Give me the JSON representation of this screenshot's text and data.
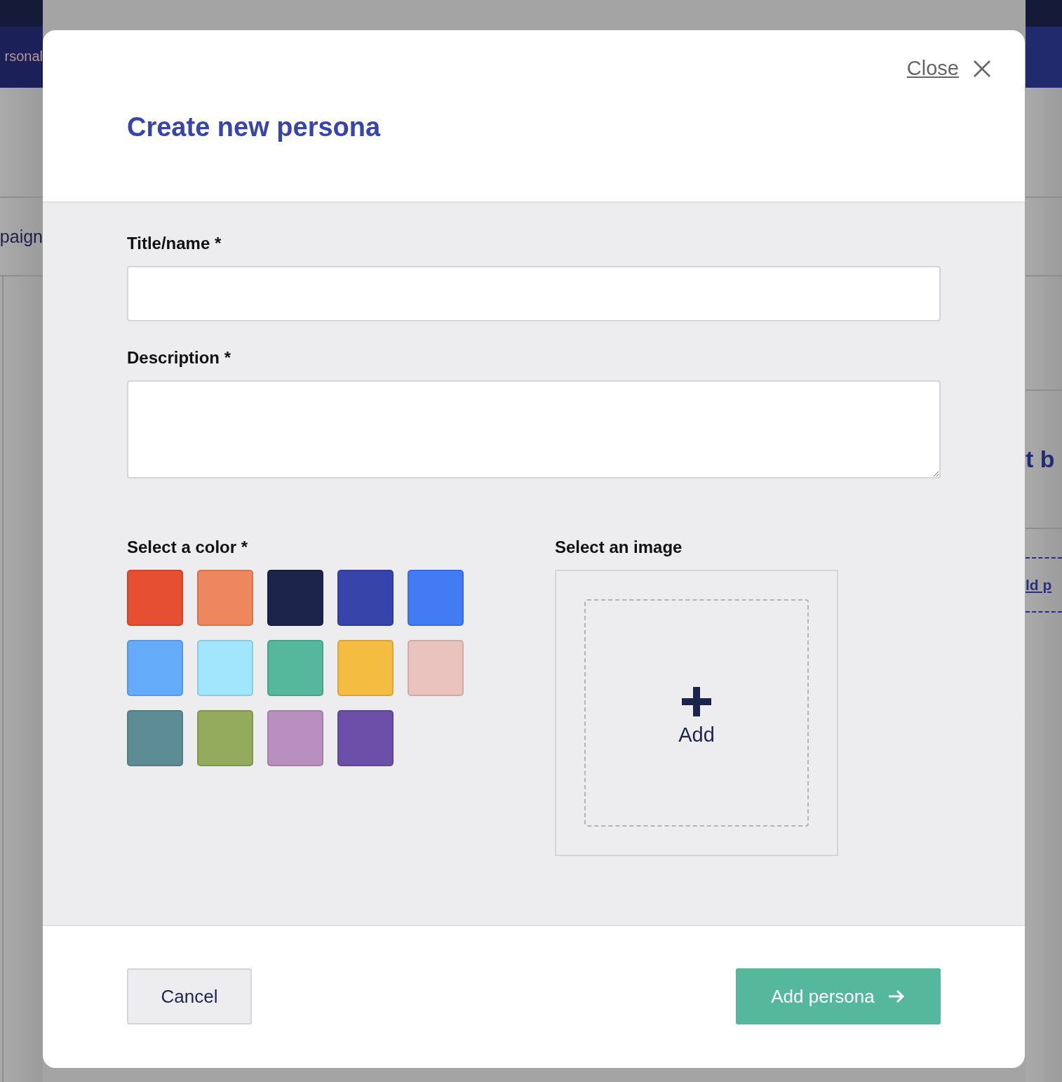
{
  "background": {
    "nav_tab": "rsonal",
    "left_row": "paign",
    "right_heading": "t b",
    "right_link": "ld p"
  },
  "modal": {
    "close_label": "Close",
    "title": "Create new persona",
    "fields": [
      {
        "kind": "input",
        "label": "Title/name",
        "required": "*"
      },
      {
        "kind": "textarea",
        "label": "Description",
        "required": "*"
      }
    ],
    "color_picker": {
      "label": "Select a color",
      "required": "*",
      "swatches": [
        {
          "color": "#e74f32",
          "selected": false
        },
        {
          "color": "#ef875e",
          "selected": false
        },
        {
          "color": "#1b244b",
          "selected": false
        },
        {
          "color": "#3745ab",
          "selected": false
        },
        {
          "color": "#437bf5",
          "selected": false
        },
        {
          "color": "#64acfa",
          "selected": false
        },
        {
          "color": "#a1e6fb",
          "selected": false
        },
        {
          "color": "#55b89c",
          "selected": false
        },
        {
          "color": "#f4bd42",
          "selected": false
        },
        {
          "color": "#ebc3be",
          "selected": false
        },
        {
          "color": "#5e8c94",
          "selected": false
        },
        {
          "color": "#94aa5d",
          "selected": false
        },
        {
          "color": "#b98fc0",
          "selected": false
        },
        {
          "color": "#6b4fa8",
          "selected": false
        }
      ]
    },
    "image_picker": {
      "label": "Select an image",
      "add_label": "Add"
    },
    "buttons": [
      {
        "kind": "secondary",
        "label": "Cancel"
      },
      {
        "kind": "primary",
        "label": "Add persona"
      }
    ]
  }
}
